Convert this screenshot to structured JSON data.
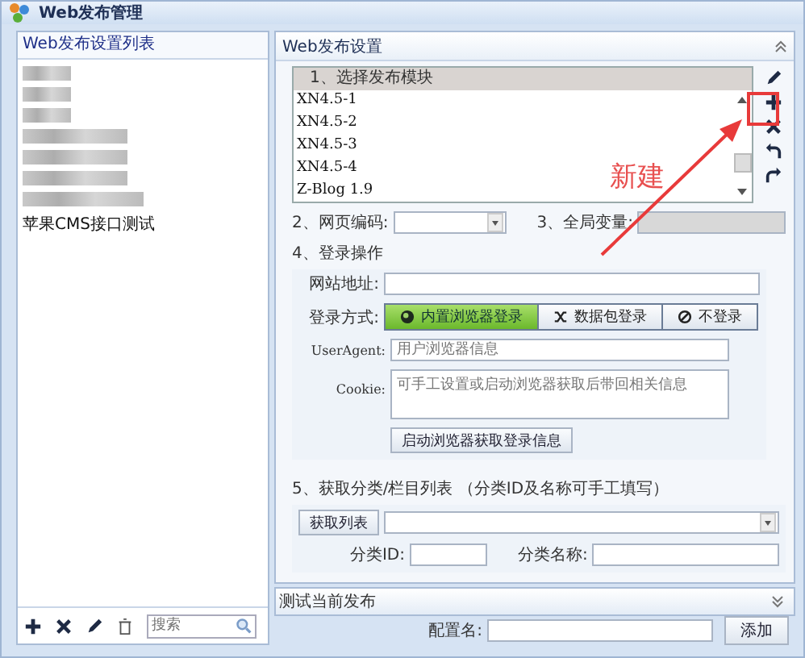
{
  "window": {
    "title": "Web发布管理"
  },
  "left_panel": {
    "title": "Web发布设置列表",
    "items": [
      {
        "kind": "redacted"
      },
      {
        "kind": "redacted"
      },
      {
        "kind": "redacted"
      },
      {
        "kind": "redacted"
      },
      {
        "kind": "redacted"
      },
      {
        "kind": "redacted"
      },
      {
        "kind": "redacted"
      },
      {
        "kind": "text",
        "label": "苹果CMS接口测试"
      }
    ],
    "search": {
      "placeholder": "搜索"
    }
  },
  "right_panel": {
    "title": "Web发布设置",
    "module_list": {
      "header": "1、选择发布模块",
      "items": [
        "XN4.5-1",
        "XN4.5-2",
        "XN4.5-3",
        "XN4.5-4",
        "Z-Blog 1.9"
      ]
    },
    "encoding_label": "2、网页编码:",
    "global_var_label": "3、全局变量:",
    "login_section": "4、登录操作",
    "site_label": "网站地址:",
    "login_mode_label": "登录方式:",
    "login_modes": [
      {
        "label": "内置浏览器登录",
        "selected": true
      },
      {
        "label": "数据包登录",
        "selected": false
      },
      {
        "label": "不登录",
        "selected": false
      }
    ],
    "useragent_label": "UserAgent:",
    "useragent_placeholder": "用户浏览器信息",
    "cookie_label": "Cookie:",
    "cookie_placeholder": "可手工设置或启动浏览器获取后带回相关信息",
    "launch_button": "启动浏览器获取登录信息",
    "category_section": "5、获取分类/栏目列表 （分类ID及名称可手工填写）",
    "get_list_button": "获取列表",
    "category_id_label": "分类ID:",
    "category_name_label": "分类名称:",
    "annotation": "新建"
  },
  "test_bar": {
    "title": "测试当前发布"
  },
  "footer": {
    "config_label": "配置名:",
    "add_button": "添加"
  }
}
